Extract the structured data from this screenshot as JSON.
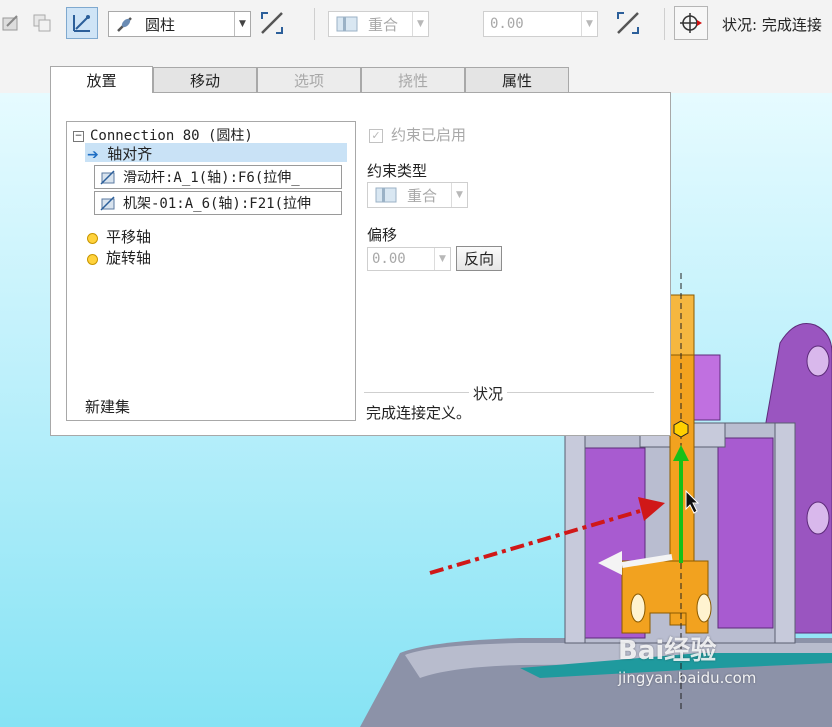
{
  "toolbar": {
    "connection_type": "圆柱",
    "constraint_type": "重合",
    "offset_value": "0.00",
    "status_text": "状况: 完成连接"
  },
  "tabs": [
    {
      "label": "放置",
      "state": "selected"
    },
    {
      "label": "移动",
      "state": "enabled"
    },
    {
      "label": "选项",
      "state": "disabled"
    },
    {
      "label": "挠性",
      "state": "disabled"
    },
    {
      "label": "属性",
      "state": "enabled"
    }
  ],
  "tree": {
    "root_label": "Connection_80 (圆柱)",
    "selected_item": "轴对齐",
    "refs": [
      "滑动杆:A_1(轴):F6(拉伸_",
      "机架-01:A_6(轴):F21(拉伸"
    ],
    "items": [
      "平移轴",
      "旋转轴"
    ],
    "new_set_label": "新建集"
  },
  "constraint": {
    "enabled_label": "约束已启用",
    "type_label": "约束类型",
    "type_value": "重合",
    "offset_label": "偏移",
    "offset_value": "0.00",
    "flip_label": "反向"
  },
  "status": {
    "title": "状况",
    "message": "完成连接定义。"
  },
  "watermark": {
    "brand": "Bai经验",
    "url": "jingyan.baidu.com"
  },
  "colors": {
    "selected_row": "#c9e2f6",
    "part_purple": "#b05fd1",
    "part_orange": "#f0a020",
    "frame_gray": "#b4b8c8",
    "viewport_sky": "#9ee8f7"
  }
}
